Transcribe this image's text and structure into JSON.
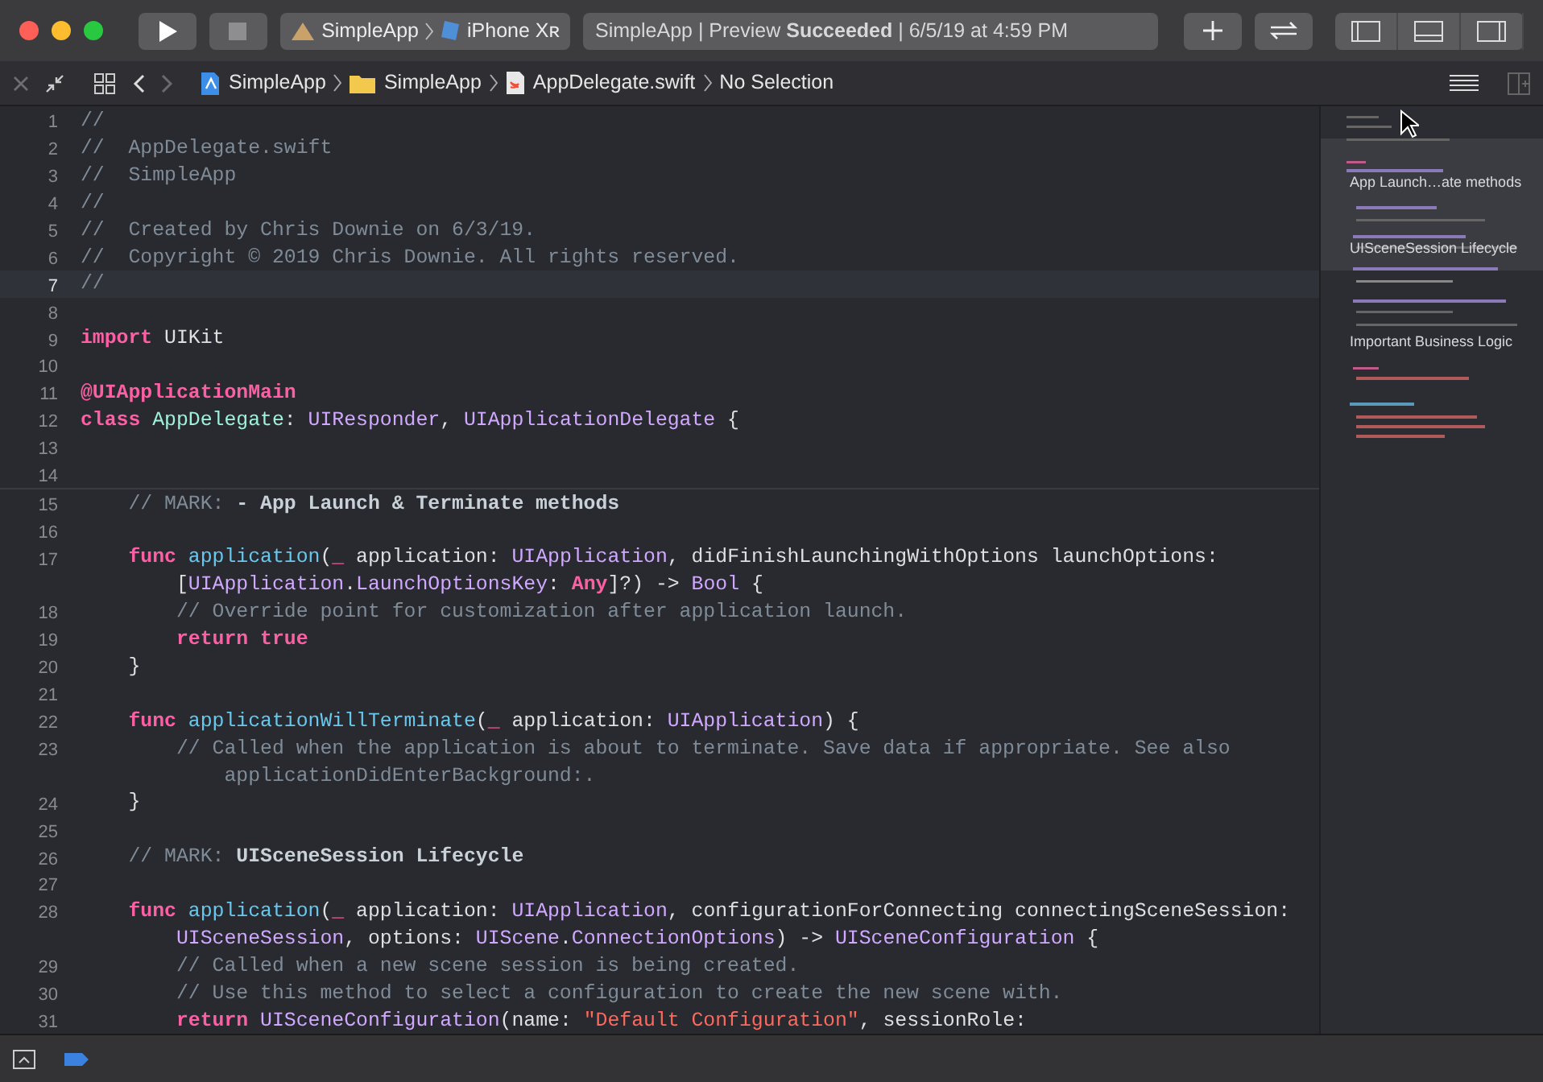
{
  "toolbar": {
    "scheme": {
      "app": "SimpleApp",
      "device": "iPhone Xʀ"
    },
    "status": "SimpleApp | Preview **Succeeded** | 6/5/19 at 4:59 PM"
  },
  "jump_bar": {
    "items": [
      {
        "kind": "project",
        "label": "SimpleApp"
      },
      {
        "kind": "folder",
        "label": "SimpleApp"
      },
      {
        "kind": "file",
        "label": "AppDelegate.swift"
      },
      {
        "kind": "plain",
        "label": "No Selection"
      }
    ]
  },
  "editor": {
    "lines": [
      {
        "number": "1",
        "current": false,
        "tokens": [
          {
            "kind": "comment",
            "text": "//"
          }
        ]
      },
      {
        "number": "2",
        "current": false,
        "tokens": [
          {
            "kind": "comment",
            "text": "//  AppDelegate.swift"
          }
        ]
      },
      {
        "number": "3",
        "current": false,
        "tokens": [
          {
            "kind": "comment",
            "text": "//  SimpleApp"
          }
        ]
      },
      {
        "number": "4",
        "current": false,
        "tokens": [
          {
            "kind": "comment",
            "text": "//"
          }
        ]
      },
      {
        "number": "5",
        "current": false,
        "tokens": [
          {
            "kind": "comment",
            "text": "//  Created by Chris Downie on 6/3/19."
          }
        ]
      },
      {
        "number": "6",
        "current": false,
        "tokens": [
          {
            "kind": "comment",
            "text": "//  Copyright © 2019 Chris Downie. All rights reserved."
          }
        ]
      },
      {
        "number": "7",
        "current": true,
        "tokens": [
          {
            "kind": "comment",
            "text": "//"
          }
        ]
      },
      {
        "number": "8",
        "current": false
      },
      {
        "number": "9",
        "current": false,
        "tokens": [
          {
            "kind": "keyword",
            "text": "import"
          },
          {
            "kind": "plain",
            "text": " UIKit"
          }
        ]
      },
      {
        "number": "10",
        "current": false
      },
      {
        "number": "11",
        "current": false,
        "tokens": [
          {
            "kind": "keyword",
            "text": "@UIApplicationMain"
          }
        ]
      },
      {
        "number": "12",
        "current": false,
        "tokens": [
          {
            "kind": "keyword",
            "text": "class"
          },
          {
            "kind": "project",
            "text": " AppDelegate"
          },
          {
            "kind": "plain",
            "text": ": "
          },
          {
            "kind": "type",
            "text": "UIResponder"
          },
          {
            "kind": "plain",
            "text": ", "
          },
          {
            "kind": "type",
            "text": "UIApplicationDelegate"
          },
          {
            "kind": "plain",
            "text": " {"
          }
        ]
      },
      {
        "number": "13",
        "current": false
      },
      {
        "number": "14",
        "current": false
      },
      {
        "number": "15",
        "current": false,
        "tokens": [
          {
            "kind": "comment",
            "text": "    // MARK: "
          },
          {
            "kind": "mark",
            "text": "- App Launch & Terminate methods"
          }
        ]
      },
      {
        "number": "16",
        "current": false
      },
      {
        "number": "17",
        "current": false,
        "tokens": [
          {
            "kind": "keyword",
            "text": "    func"
          },
          {
            "kind": "func",
            "text": " application"
          },
          {
            "kind": "plain",
            "text": "("
          },
          {
            "kind": "keyword",
            "text": "_"
          },
          {
            "kind": "plain",
            "text": " application: "
          },
          {
            "kind": "type",
            "text": "UIApplication"
          },
          {
            "kind": "plain",
            "text": ", didFinishLaunchingWithOptions launchOptions:"
          }
        ],
        "continuation": [
          {
            "kind": "plain",
            "text": "        ["
          },
          {
            "kind": "type",
            "text": "UIApplication"
          },
          {
            "kind": "plain",
            "text": "."
          },
          {
            "kind": "type",
            "text": "LaunchOptionsKey"
          },
          {
            "kind": "plain",
            "text": ": "
          },
          {
            "kind": "keyword",
            "text": "Any"
          },
          {
            "kind": "plain",
            "text": "]?) -> "
          },
          {
            "kind": "type",
            "text": "Bool"
          },
          {
            "kind": "plain",
            "text": " {"
          }
        ]
      },
      {
        "number": "18",
        "current": false,
        "tokens": [
          {
            "kind": "comment",
            "text": "        // Override point for customization after application launch."
          }
        ]
      },
      {
        "number": "19",
        "current": false,
        "tokens": [
          {
            "kind": "keyword",
            "text": "        return"
          },
          {
            "kind": "keyword",
            "text": " true"
          }
        ]
      },
      {
        "number": "20",
        "current": false,
        "tokens": [
          {
            "kind": "plain",
            "text": "    }"
          }
        ]
      },
      {
        "number": "21",
        "current": false
      },
      {
        "number": "22",
        "current": false,
        "tokens": [
          {
            "kind": "keyword",
            "text": "    func"
          },
          {
            "kind": "func",
            "text": " applicationWillTerminate"
          },
          {
            "kind": "plain",
            "text": "("
          },
          {
            "kind": "keyword",
            "text": "_"
          },
          {
            "kind": "plain",
            "text": " application: "
          },
          {
            "kind": "type",
            "text": "UIApplication"
          },
          {
            "kind": "plain",
            "text": ") {"
          }
        ]
      },
      {
        "number": "23",
        "current": false,
        "tokens": [
          {
            "kind": "comment",
            "text": "        // Called when the application is about to terminate. Save data if appropriate. See also"
          }
        ],
        "continuation": [
          {
            "kind": "comment",
            "text": "            applicationDidEnterBackground:."
          }
        ]
      },
      {
        "number": "24",
        "current": false,
        "tokens": [
          {
            "kind": "plain",
            "text": "    }"
          }
        ]
      },
      {
        "number": "25",
        "current": false
      },
      {
        "number": "26",
        "current": false,
        "tokens": [
          {
            "kind": "comment",
            "text": "    // MARK: "
          },
          {
            "kind": "mark",
            "text": "UISceneSession Lifecycle"
          }
        ]
      },
      {
        "number": "27",
        "current": false
      },
      {
        "number": "28",
        "current": false,
        "tokens": [
          {
            "kind": "keyword",
            "text": "    func"
          },
          {
            "kind": "func",
            "text": " application"
          },
          {
            "kind": "plain",
            "text": "("
          },
          {
            "kind": "keyword",
            "text": "_"
          },
          {
            "kind": "plain",
            "text": " application: "
          },
          {
            "kind": "type",
            "text": "UIApplication"
          },
          {
            "kind": "plain",
            "text": ", configurationForConnecting connectingSceneSession:"
          }
        ],
        "continuation": [
          {
            "kind": "type",
            "text": "        UISceneSession"
          },
          {
            "kind": "plain",
            "text": ", options: "
          },
          {
            "kind": "type",
            "text": "UIScene"
          },
          {
            "kind": "plain",
            "text": "."
          },
          {
            "kind": "type",
            "text": "ConnectionOptions"
          },
          {
            "kind": "plain",
            "text": ") -> "
          },
          {
            "kind": "type",
            "text": "UISceneConfiguration"
          },
          {
            "kind": "plain",
            "text": " {"
          }
        ]
      },
      {
        "number": "29",
        "current": false,
        "tokens": [
          {
            "kind": "comment",
            "text": "        // Called when a new scene session is being created."
          }
        ]
      },
      {
        "number": "30",
        "current": false,
        "tokens": [
          {
            "kind": "comment",
            "text": "        // Use this method to select a configuration to create the new scene with."
          }
        ]
      },
      {
        "number": "31",
        "current": false,
        "tokens": [
          {
            "kind": "keyword",
            "text": "        return"
          },
          {
            "kind": "type",
            "text": " UISceneConfiguration"
          },
          {
            "kind": "plain",
            "text": "(name: "
          },
          {
            "kind": "string",
            "text": "\"Default Configuration\""
          },
          {
            "kind": "plain",
            "text": ", sessionRole:"
          }
        ]
      }
    ]
  },
  "minimap": {
    "sections": [
      "App Launch…ate methods",
      "UISceneSession Lifecycle",
      "Important Business Logic"
    ]
  }
}
